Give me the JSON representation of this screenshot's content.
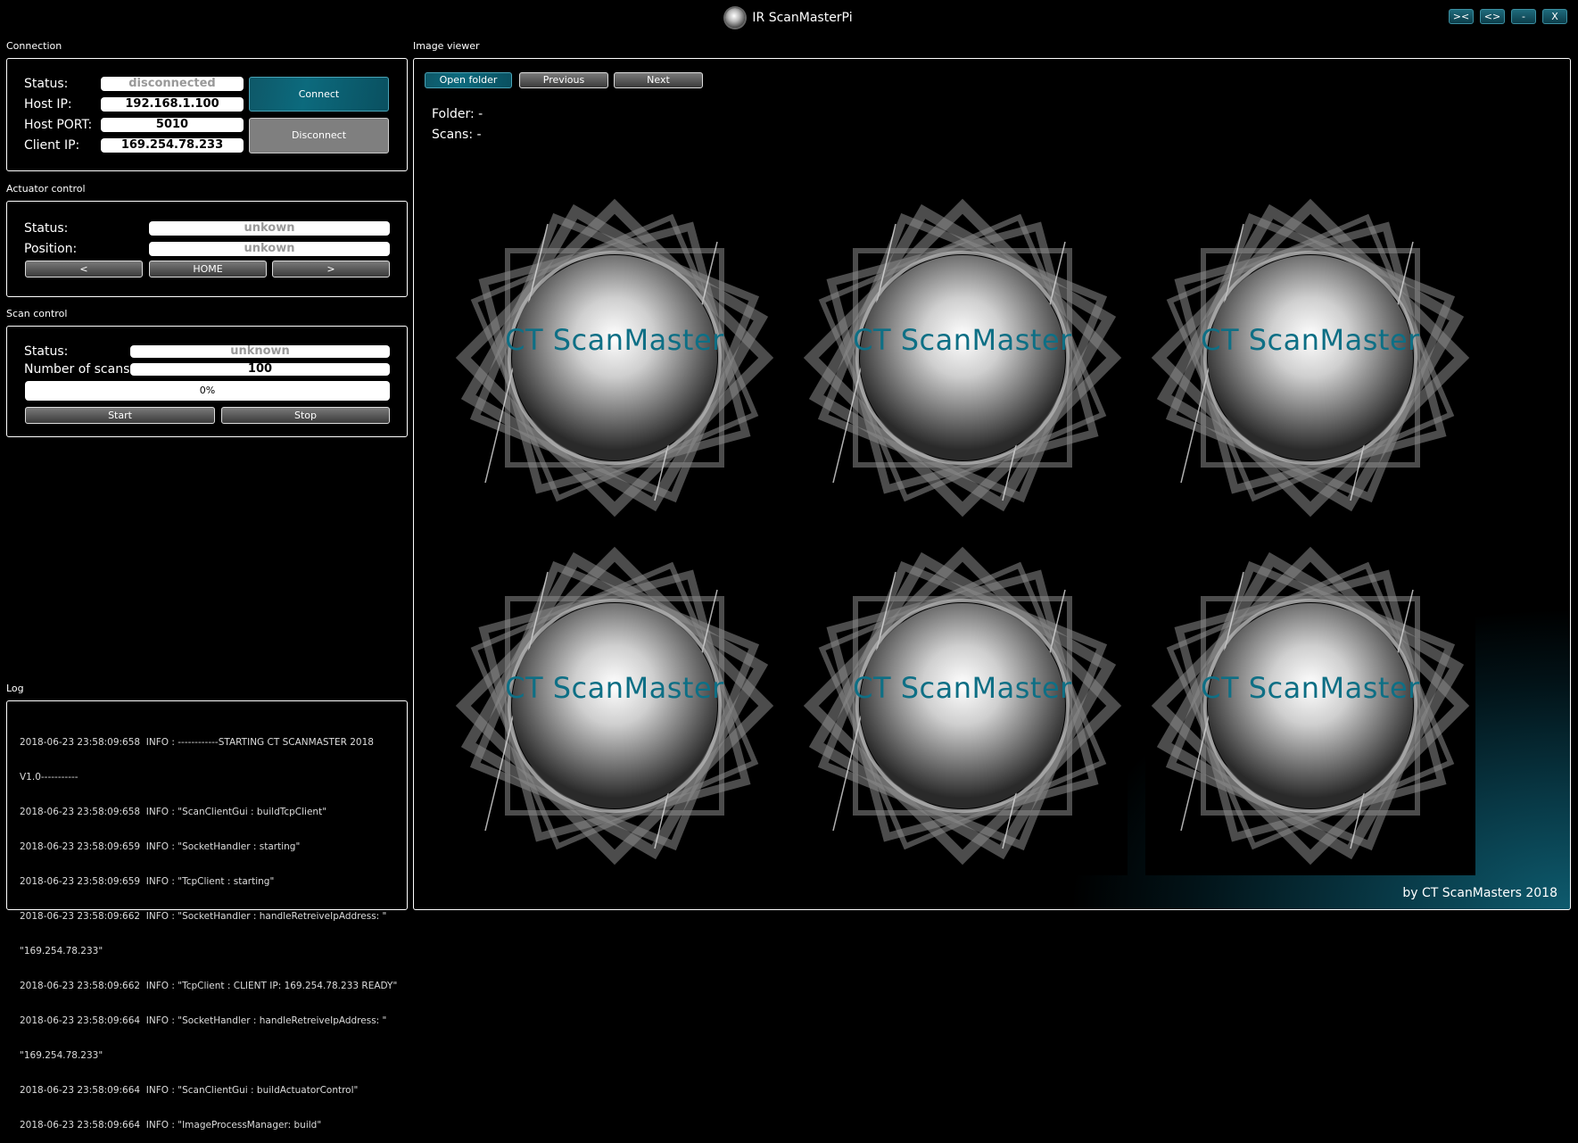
{
  "window": {
    "title": "IR ScanMasterPi",
    "buttons": [
      "><",
      "<>",
      "-",
      "X"
    ]
  },
  "connection": {
    "section_label": "Connection",
    "status_label": "Status:",
    "status_value": "disconnected",
    "host_ip_label": "Host IP:",
    "host_ip_value": "192.168.1.100",
    "host_port_label": "Host PORT:",
    "host_port_value": "5010",
    "client_ip_label": "Client IP:",
    "client_ip_value": "169.254.78.233",
    "connect_label": "Connect",
    "disconnect_label": "Disconnect"
  },
  "actuator": {
    "section_label": "Actuator control",
    "status_label": "Status:",
    "status_value": "unkown",
    "position_label": "Position:",
    "position_value": "unkown",
    "left_label": "<",
    "home_label": "HOME",
    "right_label": ">"
  },
  "scan": {
    "section_label": "Scan control",
    "status_label": "Status:",
    "status_value": "unknown",
    "num_label": "Number of scans:",
    "num_value": "100",
    "progress_text": "0%",
    "progress_fraction": 0,
    "start_label": "Start",
    "stop_label": "Stop"
  },
  "log": {
    "section_label": "Log",
    "lines": [
      "2018-06-23 23:58:09:658  INFO : ------------STARTING CT SCANMASTER 2018",
      "V1.0-----------",
      "2018-06-23 23:58:09:658  INFO : \"ScanClientGui : buildTcpClient\"",
      "2018-06-23 23:58:09:659  INFO : \"SocketHandler : starting\"",
      "2018-06-23 23:58:09:659  INFO : \"TcpClient : starting\"",
      "2018-06-23 23:58:09:662  INFO : \"SocketHandler : handleRetreiveIpAddress: \"",
      "\"169.254.78.233\"",
      "2018-06-23 23:58:09:662  INFO : \"TcpClient : CLIENT IP: 169.254.78.233 READY\"",
      "2018-06-23 23:58:09:664  INFO : \"SocketHandler : handleRetreiveIpAddress: \"",
      "\"169.254.78.233\"",
      "2018-06-23 23:58:09:664  INFO : \"ScanClientGui : buildActuatorControl\"",
      "2018-06-23 23:58:09:664  INFO : \"ImageProcessManager: build\""
    ]
  },
  "viewer": {
    "section_label": "Image viewer",
    "open_label": "Open folder",
    "previous_label": "Previous",
    "next_label": "Next",
    "folder_label": "Folder: -",
    "scans_label": "Scans: -",
    "thumbnail_caption": "CT ScanMaster",
    "credit": "by CT ScanMasters 2018"
  },
  "colors": {
    "accent": "#0c6a7d",
    "caption": "#0e6f85"
  }
}
